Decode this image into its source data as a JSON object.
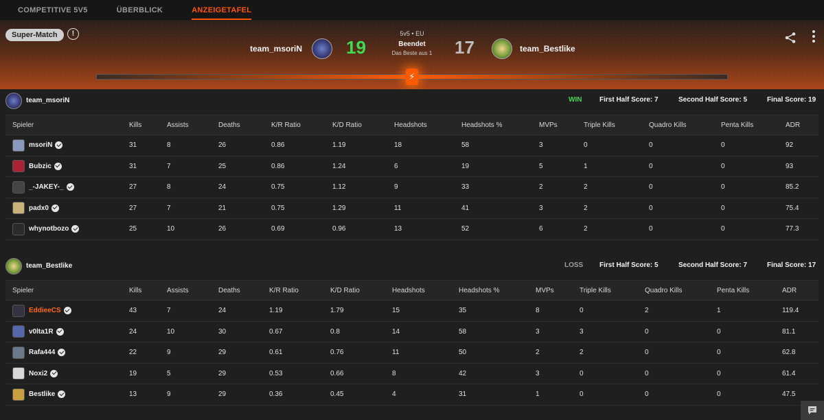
{
  "nav": {
    "tabs": [
      {
        "label": "COMPETITIVE 5V5"
      },
      {
        "label": "ÜBERBLICK"
      },
      {
        "label": "ANZEIGETAFEL"
      }
    ]
  },
  "header": {
    "super_match": "Super-Match",
    "info_glyph": "!",
    "mode": "5v5 • EU",
    "status": "Beendet",
    "best_of": "Das Beste aus 1",
    "progress": 0.5,
    "team_left": {
      "name": "team_msoriN",
      "score": "19"
    },
    "team_right": {
      "name": "team_Bestlike",
      "score": "17"
    }
  },
  "columns": [
    "Spieler",
    "Kills",
    "Assists",
    "Deaths",
    "K/R Ratio",
    "K/D Ratio",
    "Headshots",
    "Headshots %",
    "MVPs",
    "Triple Kills",
    "Quadro Kills",
    "Penta Kills",
    "ADR"
  ],
  "teams": [
    {
      "name": "team_msoriN",
      "result": "WIN",
      "first_half": "First Half Score: 7",
      "second_half": "Second Half Score: 5",
      "final": "Final Score: 19",
      "players": [
        {
          "name": "msoriN",
          "stats": [
            "31",
            "8",
            "26",
            "0.86",
            "1.19",
            "18",
            "58",
            "3",
            "0",
            "0",
            "0",
            "92"
          ]
        },
        {
          "name": "Bubzic",
          "stats": [
            "31",
            "7",
            "25",
            "0.86",
            "1.24",
            "6",
            "19",
            "5",
            "1",
            "0",
            "0",
            "93"
          ]
        },
        {
          "name": "_-JAKEY-_",
          "stats": [
            "27",
            "8",
            "24",
            "0.75",
            "1.12",
            "9",
            "33",
            "2",
            "2",
            "0",
            "0",
            "85.2"
          ]
        },
        {
          "name": "padx0",
          "stats": [
            "27",
            "7",
            "21",
            "0.75",
            "1.29",
            "11",
            "41",
            "3",
            "2",
            "0",
            "0",
            "75.4"
          ]
        },
        {
          "name": "whynotbozo",
          "stats": [
            "25",
            "10",
            "26",
            "0.69",
            "0.96",
            "13",
            "52",
            "6",
            "2",
            "0",
            "0",
            "77.3"
          ]
        }
      ]
    },
    {
      "name": "team_Bestlike",
      "result": "LOSS",
      "first_half": "First Half Score: 5",
      "second_half": "Second Half Score: 7",
      "final": "Final Score: 17",
      "players": [
        {
          "name": "EddieeCS",
          "stats": [
            "43",
            "7",
            "24",
            "1.19",
            "1.79",
            "15",
            "35",
            "8",
            "0",
            "2",
            "1",
            "119.4"
          ]
        },
        {
          "name": "v0lta1R",
          "stats": [
            "24",
            "10",
            "30",
            "0.67",
            "0.8",
            "14",
            "58",
            "3",
            "3",
            "0",
            "0",
            "81.1"
          ]
        },
        {
          "name": "Rafa444",
          "stats": [
            "22",
            "9",
            "29",
            "0.61",
            "0.76",
            "11",
            "50",
            "2",
            "2",
            "0",
            "0",
            "62.8"
          ]
        },
        {
          "name": "Noxi2",
          "stats": [
            "19",
            "5",
            "29",
            "0.53",
            "0.66",
            "8",
            "42",
            "3",
            "0",
            "0",
            "0",
            "61.4"
          ]
        },
        {
          "name": "Bestlike",
          "stats": [
            "13",
            "9",
            "29",
            "0.36",
            "0.45",
            "4",
            "31",
            "1",
            "0",
            "0",
            "0",
            "47.5"
          ]
        }
      ]
    }
  ]
}
